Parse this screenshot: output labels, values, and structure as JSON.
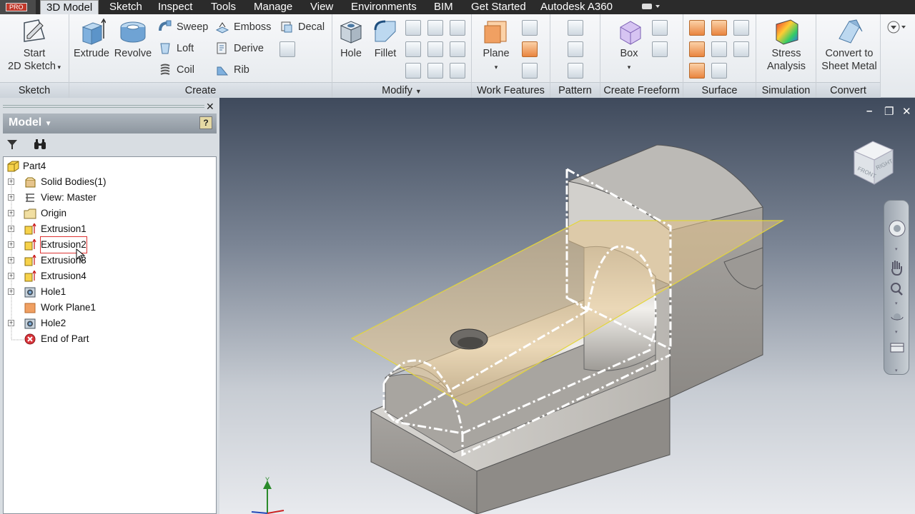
{
  "tabs": {
    "pro_badge": "PRO",
    "items": [
      "3D Model",
      "Sketch",
      "Inspect",
      "Tools",
      "Manage",
      "View",
      "Environments",
      "BIM",
      "Get Started",
      "Autodesk A360"
    ]
  },
  "ribbon": {
    "sketch": {
      "start_label_1": "Start",
      "start_label_2": "2D Sketch",
      "panel": "Sketch"
    },
    "create": {
      "extrude": "Extrude",
      "revolve": "Revolve",
      "sweep": "Sweep",
      "loft": "Loft",
      "coil": "Coil",
      "emboss": "Emboss",
      "derive": "Derive",
      "rib": "Rib",
      "decal": "Decal",
      "panel": "Create"
    },
    "modify": {
      "hole": "Hole",
      "fillet": "Fillet",
      "panel": "Modify"
    },
    "work_features": {
      "plane": "Plane",
      "panel": "Work Features"
    },
    "pattern": {
      "panel": "Pattern"
    },
    "freeform": {
      "box": "Box",
      "panel": "Create Freeform"
    },
    "surface": {
      "panel": "Surface"
    },
    "simulation": {
      "label_1": "Stress",
      "label_2": "Analysis",
      "panel": "Simulation"
    },
    "convert": {
      "label_1": "Convert to",
      "label_2": "Sheet Metal",
      "panel": "Convert"
    }
  },
  "browser": {
    "title": "Model",
    "help": "?",
    "nodes": [
      {
        "label": "Part4",
        "icon": "part-icon"
      },
      {
        "label": "Solid Bodies(1)",
        "icon": "solid-bodies-icon"
      },
      {
        "label": "View: Master",
        "icon": "view-icon"
      },
      {
        "label": "Origin",
        "icon": "folder-icon"
      },
      {
        "label": "Extrusion1",
        "icon": "extrusion-icon"
      },
      {
        "label": "Extrusion2",
        "icon": "extrusion-icon"
      },
      {
        "label": "Extrusion3",
        "icon": "extrusion-icon"
      },
      {
        "label": "Extrusion4",
        "icon": "extrusion-icon"
      },
      {
        "label": "Hole1",
        "icon": "hole-icon"
      },
      {
        "label": "Work Plane1",
        "icon": "work-plane-icon"
      },
      {
        "label": "Hole2",
        "icon": "hole-icon"
      },
      {
        "label": "End of Part",
        "icon": "end-of-part-icon"
      }
    ]
  },
  "viewcube": {
    "face_front": "FRONT",
    "face_right": "RIGHT"
  },
  "colors": {
    "accent_orange": "#e9843f",
    "tabbar": "#2b2b2b",
    "work_plane": "#e6c48c"
  }
}
